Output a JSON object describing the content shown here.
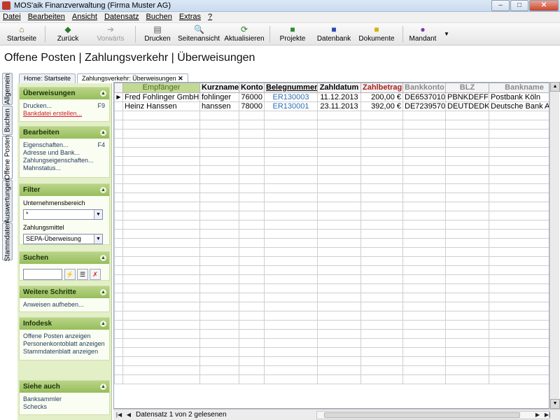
{
  "window": {
    "title": "MOS'aik Finanzverwaltung (Firma Muster AG)",
    "min": "–",
    "max": "□",
    "close": "✕"
  },
  "menu": [
    "Datei",
    "Bearbeiten",
    "Ansicht",
    "Datensatz",
    "Buchen",
    "Extras",
    "?"
  ],
  "toolbar": {
    "startseite": "Startseite",
    "zurueck": "Zurück",
    "vorwaerts": "Vorwärts",
    "drucken": "Drucken",
    "seitenansicht": "Seitenansicht",
    "aktualisieren": "Aktualisieren",
    "projekte": "Projekte",
    "datenbank": "Datenbank",
    "dokumente": "Dokumente",
    "mandant": "Mandant"
  },
  "page_title": "Offene Posten | Zahlungsverkehr | Überweisungen",
  "vtabs": [
    "Allgemein",
    "Buchen",
    "Offene Posten",
    "Auswertungen",
    "Stammdaten"
  ],
  "doc_tabs": {
    "home": "Home: Startseite",
    "active": "Zahlungsverkehr: Überweisungen",
    "close": "✕"
  },
  "taskpane": {
    "ueberweisungen": {
      "title": "Überweisungen",
      "drucken": "Drucken...",
      "drucken_key": "F9",
      "bankdatei": "Bankdatei erstellen..."
    },
    "bearbeiten": {
      "title": "Bearbeiten",
      "items": [
        "Eigenschaften...",
        "Adresse und Bank...",
        "Zahlungseigenschaften...",
        "Mahnstatus..."
      ],
      "key": "F4"
    },
    "filter": {
      "title": "Filter",
      "label1": "Unternehmensbereich",
      "value1": "*",
      "label2": "Zahlungsmittel",
      "value2": "SEPA-Überweisung"
    },
    "suchen": {
      "title": "Suchen"
    },
    "weitere": {
      "title": "Weitere Schritte",
      "items": [
        "Anweisen aufheben..."
      ]
    },
    "infodesk": {
      "title": "Infodesk",
      "items": [
        "Offene Posten anzeigen",
        "Personenkontoblatt anzeigen",
        "Stammdatenblatt anzeigen"
      ]
    },
    "siehe": {
      "title": "Siehe auch",
      "items": [
        "Banksammler",
        "Schecks"
      ]
    }
  },
  "grid": {
    "columns": [
      "Empfänger",
      "Kurzname",
      "Konto",
      "Belegnummer",
      "Zahldatum",
      "Zahlbetrag",
      "Bankkonto",
      "BLZ",
      "Bankname"
    ],
    "rows": [
      {
        "empfaenger": "Fred Fohlinger GmbH",
        "kurzname": "fohlinger",
        "konto": "76000",
        "beleg": "ER130003",
        "datum": "11.12.2013",
        "betrag": "200,00 €",
        "bankkonto": "DE6537010",
        "blz": "PBNKDEFF",
        "bankname": "Postbank Köln"
      },
      {
        "empfaenger": "Heinz Hanssen",
        "kurzname": "hanssen",
        "konto": "78000",
        "beleg": "ER130001",
        "datum": "23.11.2013",
        "betrag": "392,00 €",
        "bankkonto": "DE7239570",
        "blz": "DEUTDEDK",
        "bankname": "Deutsche Bank AG"
      }
    ]
  },
  "navigator": {
    "status": "Datensatz 1 von 2 gelesenen"
  },
  "colors": {
    "accent_green": "#97bd5c",
    "link_blue": "#2d6fb4",
    "red_text": "#d0202a"
  }
}
